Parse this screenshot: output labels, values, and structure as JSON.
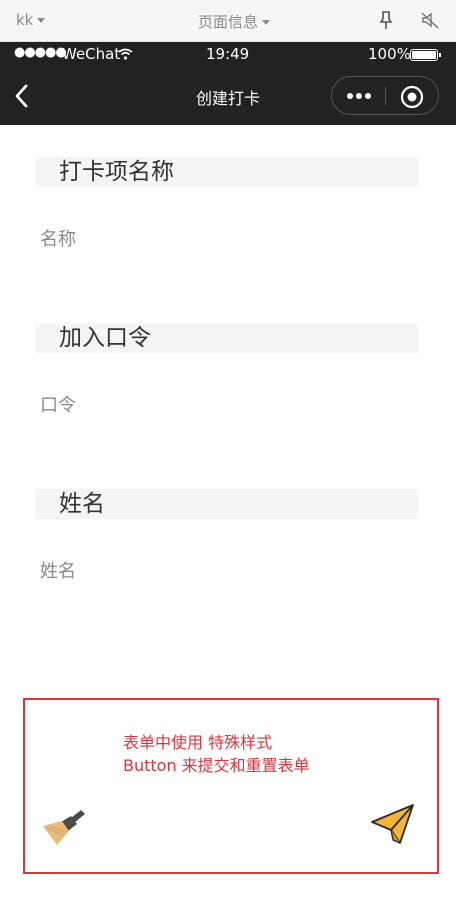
{
  "devtools": {
    "account": "kk",
    "page_info": "页面信息"
  },
  "status_bar": {
    "signal": "●●●●●",
    "carrier": "WeChat",
    "time": "19:49",
    "battery": "100%"
  },
  "nav": {
    "title": "创建打卡"
  },
  "form": {
    "sections": [
      {
        "header": "打卡项名称",
        "placeholder": "名称"
      },
      {
        "header": "加入口令",
        "placeholder": "口令"
      },
      {
        "header": "姓名",
        "placeholder": "姓名"
      }
    ]
  },
  "footer": {
    "note_line1": "表单中使用  特殊样式",
    "note_line2": "Button 来提交和重置表单",
    "accent_color": "#d9363e",
    "reset_icon": "broom-icon",
    "submit_icon": "paper-plane-icon"
  }
}
